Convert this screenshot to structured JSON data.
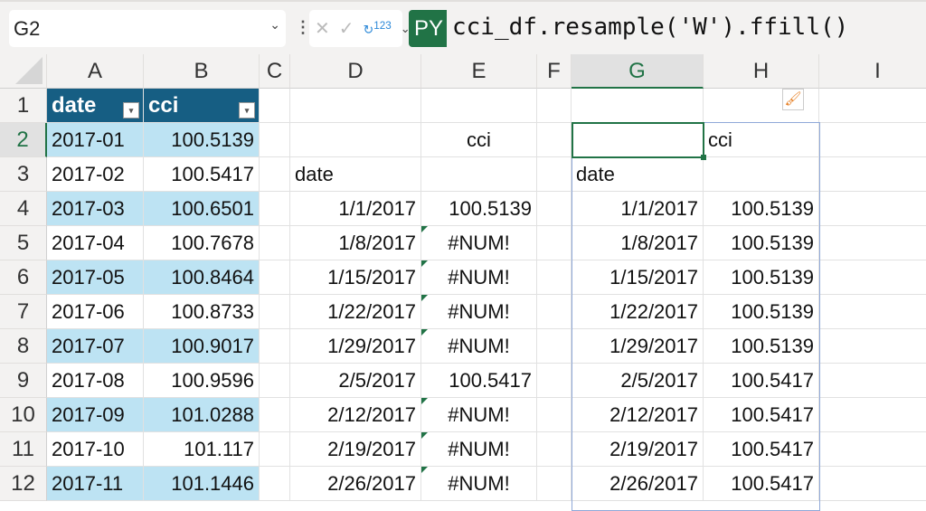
{
  "formula_bar": {
    "name_box": "G2",
    "py_badge": "PY",
    "formula": "cci_df.resample('W').ffill()",
    "cancel": "✕",
    "enter": "✓",
    "return_type": "123"
  },
  "columns": [
    "A",
    "B",
    "C",
    "D",
    "E",
    "F",
    "G",
    "H",
    "I"
  ],
  "rows": [
    "1",
    "2",
    "3",
    "4",
    "5",
    "6",
    "7",
    "8",
    "9",
    "10",
    "11",
    "12"
  ],
  "table": {
    "headers": [
      "date",
      "cci"
    ],
    "rows": [
      [
        "2017-01",
        "100.5139"
      ],
      [
        "2017-02",
        "100.5417"
      ],
      [
        "2017-03",
        "100.6501"
      ],
      [
        "2017-04",
        "100.7678"
      ],
      [
        "2017-05",
        "100.8464"
      ],
      [
        "2017-06",
        "100.8733"
      ],
      [
        "2017-07",
        "100.9017"
      ],
      [
        "2017-08",
        "100.9596"
      ],
      [
        "2017-09",
        "101.0288"
      ],
      [
        "2017-10",
        "101.117"
      ],
      [
        "2017-11",
        "101.1446"
      ]
    ]
  },
  "output_d": {
    "col_label": "cci",
    "index_label": "date",
    "rows": [
      [
        "1/1/2017",
        "100.5139"
      ],
      [
        "1/8/2017",
        "#NUM!"
      ],
      [
        "1/15/2017",
        "#NUM!"
      ],
      [
        "1/22/2017",
        "#NUM!"
      ],
      [
        "1/29/2017",
        "#NUM!"
      ],
      [
        "2/5/2017",
        "100.5417"
      ],
      [
        "2/12/2017",
        "#NUM!"
      ],
      [
        "2/19/2017",
        "#NUM!"
      ],
      [
        "2/26/2017",
        "#NUM!"
      ]
    ]
  },
  "output_g": {
    "col_label": "cci",
    "index_label": "date",
    "rows": [
      [
        "1/1/2017",
        "100.5139"
      ],
      [
        "1/8/2017",
        "100.5139"
      ],
      [
        "1/15/2017",
        "100.5139"
      ],
      [
        "1/22/2017",
        "100.5139"
      ],
      [
        "1/29/2017",
        "100.5139"
      ],
      [
        "2/5/2017",
        "100.5417"
      ],
      [
        "2/12/2017",
        "100.5417"
      ],
      [
        "2/19/2017",
        "100.5417"
      ],
      [
        "2/26/2017",
        "100.5417"
      ]
    ]
  }
}
